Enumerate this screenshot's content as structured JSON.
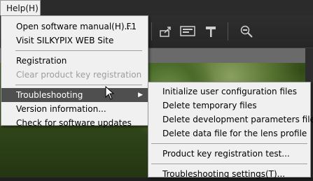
{
  "menubar": {
    "help_label": "Help(H)"
  },
  "toolbar": {
    "icons": [
      "export-icon",
      "display-icon",
      "hammer-icon",
      "zoom-icon"
    ]
  },
  "help_menu": {
    "items": [
      {
        "label": "Open software manual(H)...",
        "shortcut": "F1",
        "disabled": false
      },
      {
        "label": "Visit SILKYPIX WEB Site",
        "disabled": false
      },
      {
        "label": "Registration",
        "disabled": false
      },
      {
        "label": "Clear product key registration",
        "disabled": true
      },
      {
        "label": "Troubleshooting",
        "submenu": true,
        "highlighted": true
      },
      {
        "label": "Version information...",
        "disabled": false
      },
      {
        "label": "Check for software updates",
        "disabled": false
      }
    ]
  },
  "troubleshooting_menu": {
    "items": [
      {
        "label": "Initialize user configuration files"
      },
      {
        "label": "Delete temporary files"
      },
      {
        "label": "Delete development parameters files"
      },
      {
        "label": "Delete data file for the lens profile"
      },
      {
        "label": "Product key registration test..."
      },
      {
        "label": "Troubleshooting settings(T)..."
      }
    ]
  },
  "colors": {
    "menu_bg": "#f0f0f0",
    "highlight_bg": "#4f4f4f",
    "disabled_text": "#9d9d9d",
    "app_bg": "#2b2b2b"
  }
}
